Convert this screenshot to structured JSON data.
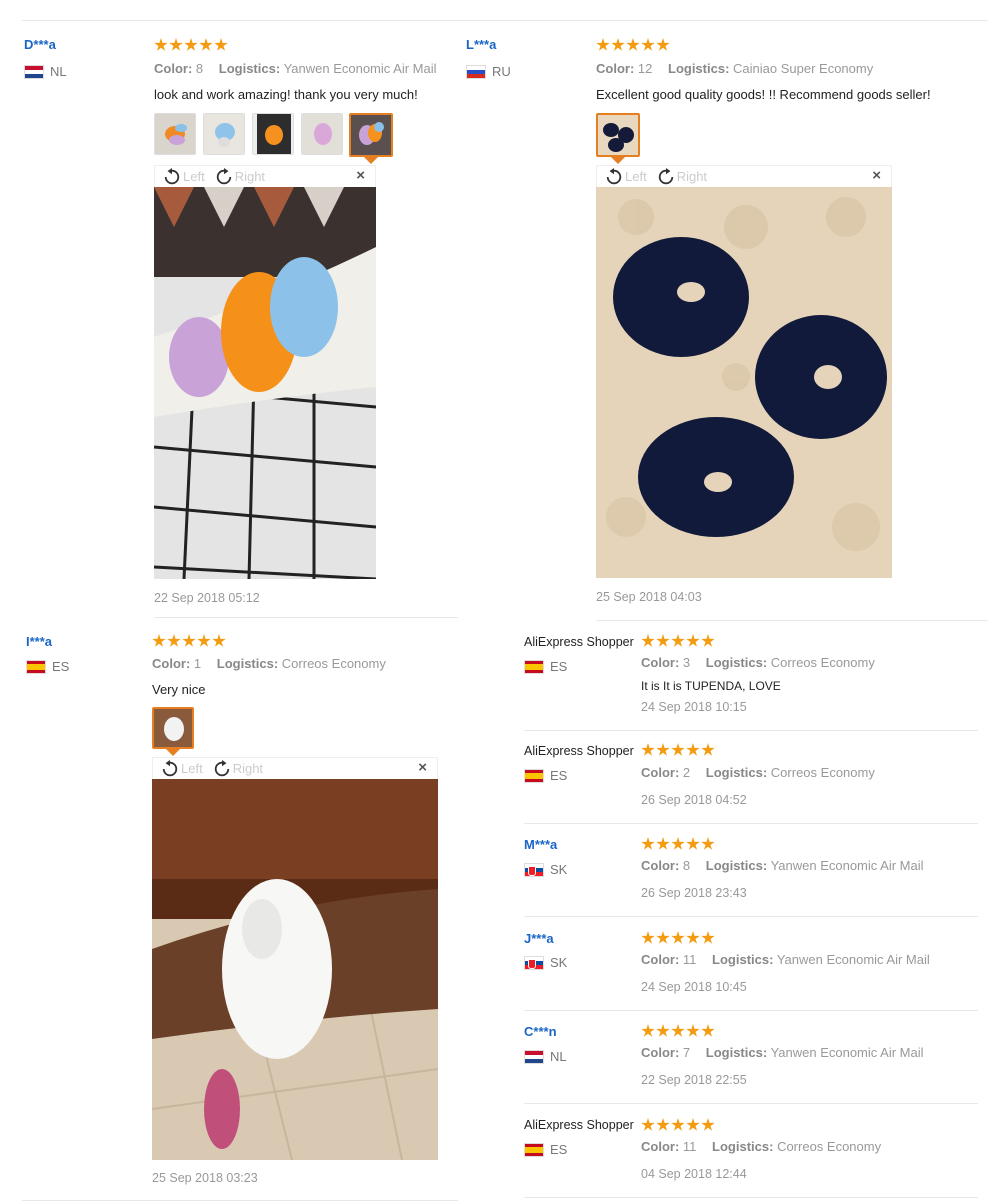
{
  "rotate_left": "Left",
  "rotate_right": "Right",
  "labels": {
    "color": "Color:",
    "logistics": "Logistics:"
  },
  "colors": {
    "accent": "#f39c12",
    "user_link": "#1a66c7",
    "thumb_active": "#e67e22"
  },
  "reviews": [
    {
      "user": "D***a",
      "country": "NL",
      "stars": 5,
      "color": "8",
      "logistics": "Yanwen Economic Air Mail",
      "text": "look and work amazing! thank you very much!",
      "date": "22 Sep 2018 05:12"
    },
    {
      "user": "L***a",
      "country": "RU",
      "stars": 5,
      "color": "12",
      "logistics": "Cainiao Super Economy",
      "text": "Excellent good quality goods! !! Recommend goods seller!",
      "date": "25 Sep 2018 04:03"
    },
    {
      "user": "I***a",
      "country": "ES",
      "stars": 5,
      "color": "1",
      "logistics": "Correos Economy",
      "text": "Very nice",
      "date": "25 Sep 2018 03:23"
    },
    {
      "user": "AliExpress Shopper",
      "country": "ES",
      "stars": 5,
      "color": "3",
      "logistics": "Correos Economy",
      "text": "It is It is TUPENDA, LOVE",
      "date": "24 Sep 2018 10:15"
    },
    {
      "user": "AliExpress Shopper",
      "country": "ES",
      "stars": 5,
      "color": "2",
      "logistics": "Correos Economy",
      "text": "",
      "date": "26 Sep 2018 04:52"
    },
    {
      "user": "M***a",
      "country": "SK",
      "stars": 5,
      "color": "8",
      "logistics": "Yanwen Economic Air Mail",
      "text": "",
      "date": "26 Sep 2018 23:43"
    },
    {
      "user": "J***a",
      "country": "SK",
      "stars": 5,
      "color": "11",
      "logistics": "Yanwen Economic Air Mail",
      "text": "",
      "date": "24 Sep 2018 10:45"
    },
    {
      "user": "C***n",
      "country": "NL",
      "stars": 5,
      "color": "7",
      "logistics": "Yanwen Economic Air Mail",
      "text": "",
      "date": "22 Sep 2018 22:55"
    },
    {
      "user": "AliExpress Shopper",
      "country": "ES",
      "stars": 5,
      "color": "11",
      "logistics": "Correos Economy",
      "text": "",
      "date": "04 Sep 2018 12:44"
    }
  ]
}
